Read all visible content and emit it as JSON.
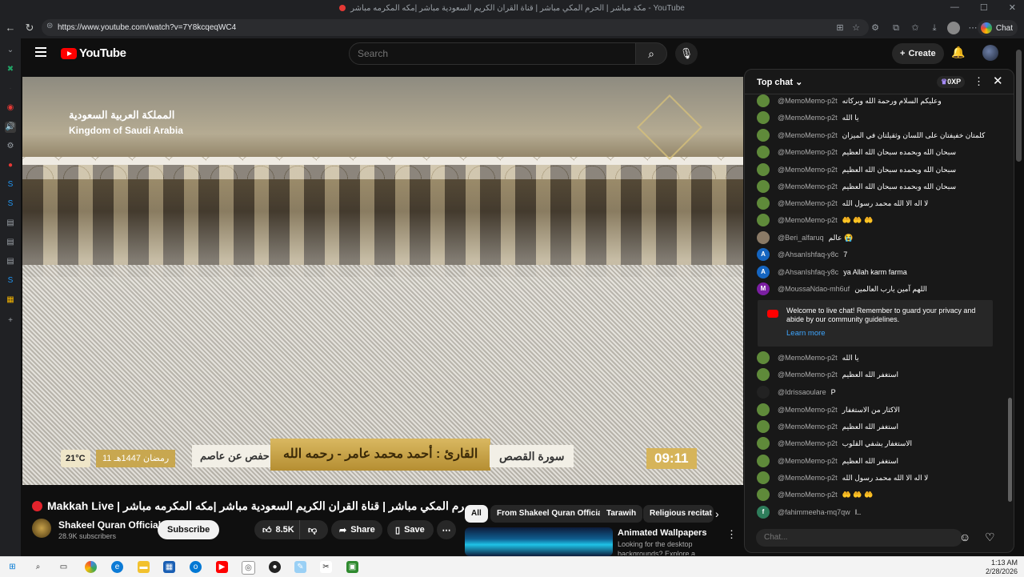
{
  "browser": {
    "tab_title": "مكة مباشر | الحرم المكي مباشر | قناة القران الكريم السعودية مباشر |مكه المكرمه مباشر - YouTube",
    "url": "https://www.youtube.com/watch?v=7Y8kcqeqWC4",
    "chat_button": "Chat"
  },
  "youtube": {
    "logo_text": "YouTube",
    "search_placeholder": "Search",
    "create_label": "Create"
  },
  "video_overlay": {
    "kingdom_ar": "المملكة العربية السعودية",
    "kingdom_en": "Kingdom of Saudi Arabia",
    "temperature": "21°C",
    "hijri_date": "11 رمضان 1447هـ",
    "riwaya": "رواية حفص عن عاصم",
    "qari": "القارئ : أحمد محمد عامر - رحمه الله",
    "surah": "سورة القصص",
    "clock": "09:11"
  },
  "video": {
    "title": "Makkah Live | مكة مباشر | الحرم المكي مباشر | قناة القران الكريم السعودية مباشر |مكه المكرمه مباشر",
    "channel": "Shakeel Quran Official",
    "subscribers": "28.9K subscribers",
    "subscribe_label": "Subscribe",
    "likes": "8.5K",
    "share_label": "Share",
    "save_label": "Save"
  },
  "chips": [
    "All",
    "From Shakeel Quran Official",
    "Tarawih",
    "Religious recitat"
  ],
  "recommendation": {
    "title": "Animated Wallpapers",
    "desc": "Looking for the desktop backgrounds? Explore a curated"
  },
  "chat": {
    "header": "Top chat",
    "xp_badge": "0XP",
    "input_placeholder": "Chat...",
    "notice_text": "Welcome to live chat! Remember to guard your privacy and abide by our community guidelines.",
    "notice_link": "Learn more",
    "messages": [
      {
        "author": "@MemoMemo-p2t",
        "text": "وعليكم السلام ورحمة الله وبركاته",
        "avatar": "",
        "color": "#5f8a3a"
      },
      {
        "author": "@MemoMemo-p2t",
        "text": "يا الله",
        "avatar": "",
        "color": "#5f8a3a"
      },
      {
        "author": "@MemoMemo-p2t",
        "text": "كلمتان خفيفتان على اللسان وثقيلتان في الميزان",
        "avatar": "",
        "color": "#5f8a3a"
      },
      {
        "author": "@MemoMemo-p2t",
        "text": "سبحان الله وبحمده سبحان الله العظيم",
        "avatar": "",
        "color": "#5f8a3a"
      },
      {
        "author": "@MemoMemo-p2t",
        "text": "سبحان الله وبحمده سبحان الله العظيم",
        "avatar": "",
        "color": "#5f8a3a"
      },
      {
        "author": "@MemoMemo-p2t",
        "text": "سبحان الله وبحمده سبحان الله العظيم",
        "avatar": "",
        "color": "#5f8a3a"
      },
      {
        "author": "@MemoMemo-p2t",
        "text": "لا اله الا الله محمد رسول الله",
        "avatar": "",
        "color": "#5f8a3a"
      },
      {
        "author": "@MemoMemo-p2t",
        "text": "🤲 🤲 🤲",
        "avatar": "",
        "color": "#5f8a3a"
      },
      {
        "author": "@Beri_alfaruq",
        "text": "عالم 😭",
        "avatar": "",
        "color": "#8a7a66"
      },
      {
        "author": "@AhsanIshfaq-y8c",
        "text": "7",
        "avatar": "A",
        "color": "#1565c0"
      },
      {
        "author": "@AhsanIshfaq-y8c",
        "text": "ya Allah karm farma",
        "avatar": "A",
        "color": "#1565c0"
      },
      {
        "author": "@MoussaNdao-mh6uf",
        "text": "اللهم آمين يارب العالمين",
        "avatar": "M",
        "color": "#7b1fa2"
      },
      {
        "author": "@MemoMemo-p2t",
        "text": "يا الله",
        "avatar": "",
        "color": "#5f8a3a"
      },
      {
        "author": "@MemoMemo-p2t",
        "text": "استغفر الله العظيم",
        "avatar": "",
        "color": "#5f8a3a"
      },
      {
        "author": "@Idrissaoulare",
        "text": "P",
        "avatar": "",
        "color": "#222222"
      },
      {
        "author": "@MemoMemo-p2t",
        "text": "الاكثار من الاستغفار",
        "avatar": "",
        "color": "#5f8a3a"
      },
      {
        "author": "@MemoMemo-p2t",
        "text": "استغفر الله العظيم",
        "avatar": "",
        "color": "#5f8a3a"
      },
      {
        "author": "@MemoMemo-p2t",
        "text": "الاستغفار يشفي القلوب",
        "avatar": "",
        "color": "#5f8a3a"
      },
      {
        "author": "@MemoMemo-p2t",
        "text": "استغفر الله العظيم",
        "avatar": "",
        "color": "#5f8a3a"
      },
      {
        "author": "@MemoMemo-p2t",
        "text": "لا اله الا الله محمد رسول الله",
        "avatar": "",
        "color": "#5f8a3a"
      },
      {
        "author": "@MemoMemo-p2t",
        "text": "🤲 🤲 🤲",
        "avatar": "",
        "color": "#5f8a3a"
      },
      {
        "author": "@fahimmeeha-mq7qw",
        "text": "I..",
        "avatar": "f",
        "color": "#2e7d5b"
      }
    ]
  },
  "taskbar": {
    "time": "1:13 AM",
    "date": "2/28/2026"
  }
}
